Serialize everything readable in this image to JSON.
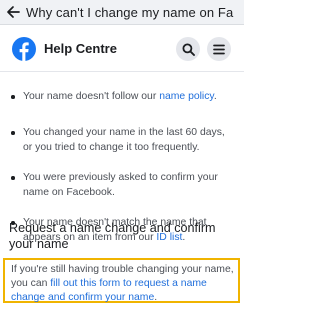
{
  "page": {
    "title": "Why can't I change my name on Fa"
  },
  "header": {
    "title": "Help Centre",
    "logo": "facebook-logo",
    "brand_color": "#1877f2"
  },
  "bullets": [
    {
      "pre": "Your name doesn't follow our ",
      "link": "name policy",
      "post": "."
    },
    {
      "pre": "You changed your name in the last 60 days, or you tried to change it too frequently.",
      "link": "",
      "post": ""
    },
    {
      "pre": "You were previously asked to confirm your name on Facebook.",
      "link": "",
      "post": ""
    },
    {
      "pre": "Your name doesn't match the name that appears on an item from our ",
      "link": "ID list",
      "post": "."
    }
  ],
  "section": {
    "heading": "Request a name change and confirm your name"
  },
  "callout": {
    "pre": "If you're still having trouble changing your name, you can ",
    "link": "fill out this form to request a name change and confirm your name",
    "post": ".",
    "border_color": "#f0b400"
  },
  "colors": {
    "link": "#216fdb",
    "text": "#4b4f56"
  }
}
